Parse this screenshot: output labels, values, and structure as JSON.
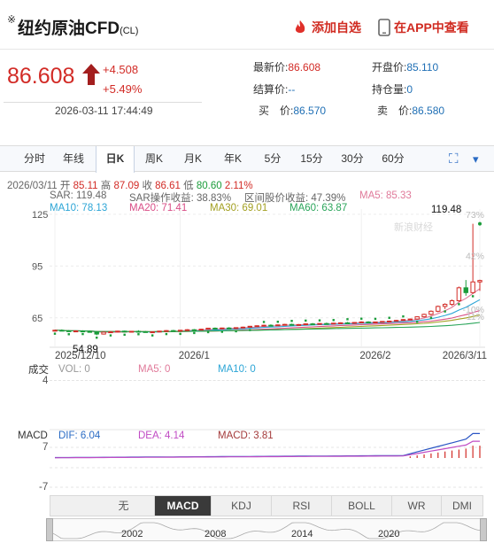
{
  "header": {
    "star": "※",
    "title": "纽约原油CFD",
    "code": "(CL)",
    "add_watch": "添加自选",
    "app_view": "在APP中查看"
  },
  "quote": {
    "price": "86.608",
    "change": "+4.508",
    "change_pct": "+5.49%",
    "time": "2026-03-11 17:44:49",
    "latest_label": "最新价:",
    "latest_value": "86.608",
    "open_label": "开盘价:",
    "open_value": "85.110",
    "settle_label": "结算价:",
    "settle_value": "--",
    "oi_label": "持仓量:",
    "oi_value": "0",
    "bid_label": "买　价:",
    "bid_value": "86.570",
    "ask_label": "卖　价:",
    "ask_value": "86.580"
  },
  "tabs": [
    "分时",
    "年线",
    "日K",
    "周K",
    "月K",
    "年K",
    "5分",
    "15分",
    "30分",
    "60分"
  ],
  "active_tab": "日K",
  "ohlc": {
    "date": "2026/03/11",
    "open_label": "开",
    "open": "85.11",
    "high_label": "高",
    "high": "87.09",
    "close_label": "收",
    "close": "86.61",
    "low_label": "低",
    "low": "80.60",
    "pct": "2.11%"
  },
  "indicators": {
    "sar": "SAR: 119.48",
    "sar_gain": "SAR操作收益: 38.83%",
    "interval_gain": "区间股价收益: 47.39%",
    "ma5": "MA5: 85.33",
    "ma10": "MA10: 78.13",
    "ma20": "MA20: 71.41",
    "ma30": "MA30: 69.01",
    "ma60": "MA60: 63.87"
  },
  "chart_data": {
    "type": "candlestick",
    "y_ticks": [
      "125",
      "95",
      "65"
    ],
    "x_ticks": [
      "2025/12/10",
      "2026/1",
      "2026/2",
      "2026/3/11"
    ],
    "annotations": {
      "high": "119.48",
      "low": "54.89"
    },
    "right_labels": [
      "73%",
      "42%",
      "-10%",
      "11%"
    ],
    "watermark": "新浪财经",
    "ylim": [
      50,
      128
    ],
    "candles": [
      [
        57.6,
        58.1,
        57.2,
        57.8
      ],
      [
        57.8,
        58.3,
        57.4,
        57.5
      ],
      [
        57.5,
        57.9,
        56.9,
        57.2
      ],
      [
        57.2,
        57.7,
        56.8,
        57.4
      ],
      [
        57.4,
        57.8,
        57.0,
        57.1
      ],
      [
        57.1,
        57.6,
        56.7,
        56.9
      ],
      [
        56.9,
        57.2,
        54.9,
        55.6
      ],
      [
        55.6,
        57.0,
        55.3,
        56.7
      ],
      [
        56.7,
        57.3,
        56.2,
        56.9
      ],
      [
        56.9,
        57.5,
        56.5,
        57.3
      ],
      [
        57.3,
        57.6,
        56.6,
        56.8
      ],
      [
        56.8,
        57.4,
        56.5,
        57.2
      ],
      [
        57.2,
        57.8,
        56.9,
        57.0
      ],
      [
        57.0,
        57.4,
        56.4,
        56.6
      ],
      [
        56.6,
        57.1,
        56.2,
        56.9
      ],
      [
        56.9,
        57.5,
        56.6,
        57.3
      ],
      [
        57.3,
        57.9,
        57.0,
        57.6
      ],
      [
        57.6,
        58.0,
        57.2,
        57.4
      ],
      [
        57.4,
        57.9,
        57.1,
        57.8
      ],
      [
        57.8,
        58.4,
        57.5,
        58.1
      ],
      [
        58.1,
        58.5,
        57.6,
        57.9
      ],
      [
        57.9,
        58.6,
        57.7,
        58.4
      ],
      [
        58.4,
        59.2,
        58.1,
        59.0
      ],
      [
        59.0,
        59.4,
        58.5,
        58.7
      ],
      [
        58.7,
        59.3,
        58.3,
        59.1
      ],
      [
        59.1,
        59.6,
        58.7,
        58.9
      ],
      [
        58.9,
        59.5,
        58.6,
        59.3
      ],
      [
        59.3,
        59.9,
        59.0,
        59.6
      ],
      [
        59.6,
        60.3,
        59.3,
        60.1
      ],
      [
        60.1,
        60.6,
        59.7,
        60.4
      ],
      [
        60.4,
        61.0,
        60.1,
        60.7
      ],
      [
        60.7,
        61.2,
        60.2,
        60.5
      ],
      [
        60.5,
        61.1,
        60.3,
        60.9
      ],
      [
        60.9,
        61.5,
        60.6,
        61.2
      ],
      [
        61.2,
        61.6,
        60.7,
        60.9
      ],
      [
        60.9,
        61.4,
        60.5,
        61.1
      ],
      [
        61.1,
        61.8,
        60.8,
        61.5
      ],
      [
        61.5,
        62.0,
        61.1,
        61.3
      ],
      [
        61.3,
        61.9,
        61.0,
        61.7
      ],
      [
        61.7,
        62.2,
        61.3,
        61.5
      ],
      [
        61.5,
        62.1,
        61.2,
        61.9
      ],
      [
        61.9,
        62.4,
        61.5,
        62.1
      ],
      [
        62.1,
        62.6,
        61.7,
        61.9
      ],
      [
        61.9,
        62.5,
        61.6,
        62.3
      ],
      [
        62.3,
        62.9,
        62.0,
        62.6
      ],
      [
        62.6,
        63.0,
        62.1,
        62.3
      ],
      [
        62.3,
        62.8,
        61.9,
        62.6
      ],
      [
        62.6,
        63.1,
        62.3,
        62.9
      ],
      [
        62.9,
        63.4,
        62.5,
        63.1
      ],
      [
        63.1,
        63.8,
        62.8,
        63.5
      ],
      [
        63.5,
        64.2,
        63.2,
        64.0
      ],
      [
        64.0,
        64.6,
        63.6,
        64.3
      ],
      [
        64.3,
        65.9,
        64.0,
        65.6
      ],
      [
        65.6,
        67.4,
        65.1,
        67.0
      ],
      [
        67.0,
        69.3,
        66.4,
        68.8
      ],
      [
        68.8,
        72.1,
        68.2,
        71.6
      ],
      [
        71.6,
        73.4,
        70.1,
        72.8
      ],
      [
        72.8,
        75.6,
        71.9,
        74.9
      ],
      [
        74.9,
        83.1,
        74.3,
        82.4
      ],
      [
        82.4,
        86.9,
        77.8,
        79.6
      ],
      [
        79.6,
        119.48,
        78.9,
        85.8
      ],
      [
        85.8,
        87.09,
        80.6,
        86.61
      ]
    ]
  },
  "volume": {
    "label": "成交",
    "vol": "VOL: 0",
    "ma5": "MA5: 0",
    "ma10": "MA10: 0",
    "y_top": "4"
  },
  "macd": {
    "label": "MACD",
    "dif": "DIF: 6.04",
    "dea": "DEA: 4.14",
    "macd": "MACD: 3.81",
    "y_top": "7",
    "y_bottom": "-7"
  },
  "indicator_buttons": [
    "无",
    "MACD",
    "KDJ",
    "RSI",
    "BOLL",
    "WR",
    "DMI"
  ],
  "active_indicator": "MACD",
  "navigator_years": [
    "2002",
    "2008",
    "2014",
    "2020"
  ],
  "colors": {
    "up": "#d22b26",
    "down": "#1a9c3a",
    "ma5": "#e07a9a",
    "ma10": "#2ca5d6",
    "ma20": "#d94d86",
    "ma30": "#a3a022",
    "ma60": "#2aa55a",
    "sar": "#1a9c3a"
  }
}
